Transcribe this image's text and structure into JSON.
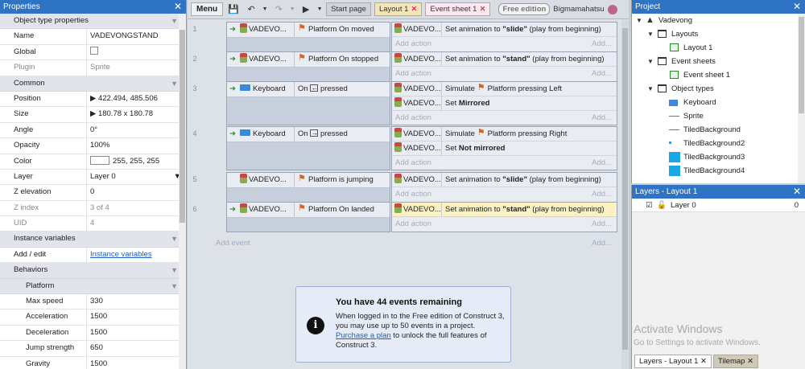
{
  "properties": {
    "title": "Properties",
    "close": "✕",
    "section_object": "Object type properties",
    "name_label": "Name",
    "name_value": "VADEVONGSTAND",
    "global_label": "Global",
    "plugin_label": "Plugin",
    "plugin_value": "Sprite",
    "section_common": "Common",
    "position_label": "Position",
    "position_value": "422.494, 485.506",
    "size_label": "Size",
    "size_value": "180.78 x 180.78",
    "angle_label": "Angle",
    "angle_value": "0°",
    "opacity_label": "Opacity",
    "opacity_value": "100%",
    "color_label": "Color",
    "color_value": "255, 255, 255",
    "layer_label": "Layer",
    "layer_value": "Layer 0",
    "zelev_label": "Z elevation",
    "zelev_value": "0",
    "zindex_label": "Z index",
    "zindex_value": "3 of 4",
    "uid_label": "UID",
    "uid_value": "4",
    "section_instvars": "Instance variables",
    "addedit_label": "Add / edit",
    "addedit_value": "Instance variables",
    "section_behaviors": "Behaviors",
    "section_platform": "Platform",
    "maxspeed_label": "Max speed",
    "maxspeed_value": "330",
    "accel_label": "Acceleration",
    "accel_value": "1500",
    "decel_label": "Deceleration",
    "decel_value": "1500",
    "jump_label": "Jump strength",
    "jump_value": "650",
    "gravity_label": "Gravity",
    "gravity_value": "1500"
  },
  "toolbar": {
    "menu": "Menu",
    "tabs": [
      "Start page",
      "Layout 1",
      "Event sheet 1"
    ],
    "edition": "Free edition",
    "user": "Bigmamahatsu"
  },
  "events": {
    "add_action": "Add action",
    "add_action_short": "Add...",
    "add_event": "Add event",
    "add_event_short": "Add...",
    "list": [
      {
        "num": "1",
        "cond_obj": "VADEVO...",
        "cond": "Platform On moved",
        "a1_obj": "VADEVO...",
        "a1_pre": "Set animation to ",
        "a1_bold": "\"slide\"",
        "a1_post": " (play from beginning)"
      },
      {
        "num": "2",
        "cond_obj": "VADEVO...",
        "cond": "Platform On stopped",
        "a1_obj": "VADEVO...",
        "a1_pre": "Set animation to ",
        "a1_bold": "\"stand\"",
        "a1_post": " (play from beginning)"
      },
      {
        "num": "3",
        "cond_obj": "Keyboard",
        "cond_on": "On",
        "cond_key": "←",
        "cond_pressed": "pressed",
        "a1_obj": "VADEVO...",
        "a1_pre": "Simulate",
        "a1_plat": "Platform pressing Left",
        "a2_obj": "VADEVO...",
        "a2_pre": "Set ",
        "a2_bold": "Mirrored"
      },
      {
        "num": "4",
        "cond_obj": "Keyboard",
        "cond_on": "On",
        "cond_key": "→",
        "cond_pressed": "pressed",
        "a1_obj": "VADEVO...",
        "a1_pre": "Simulate",
        "a1_plat": "Platform pressing Right",
        "a2_obj": "VADEVO...",
        "a2_pre": "Set ",
        "a2_bold": "Not mirrored"
      },
      {
        "num": "5",
        "cond_obj": "VADEVO...",
        "cond": "Platform is jumping",
        "a1_obj": "VADEVO...",
        "a1_pre": "Set animation to ",
        "a1_bold": "\"slide\"",
        "a1_post": " (play from beginning)"
      },
      {
        "num": "6",
        "cond_obj": "VADEVO...",
        "cond": "Platform On landed",
        "a1_obj": "VADEVO...",
        "a1_pre": "Set animation to ",
        "a1_bold": "\"stand\"",
        "a1_post": " (play from beginning)"
      }
    ]
  },
  "notice": {
    "icon": "i",
    "title": "You have 44 events remaining",
    "body_pre": "When logged in to the Free edition of Construct 3, you may use up to 50 events in a project. ",
    "link": "Purchase a plan",
    "body_post": " to unlock the full features of Construct 3."
  },
  "project": {
    "title": "Project",
    "root": "Vadevong",
    "layouts": "Layouts",
    "layout1": "Layout 1",
    "eventsheets": "Event sheets",
    "eventsheet1": "Event sheet 1",
    "objecttypes": "Object types",
    "objects": [
      "Keyboard",
      "Sprite",
      "TiledBackground",
      "TiledBackground2",
      "TiledBackground3",
      "TiledBackground4"
    ]
  },
  "layers": {
    "title": "Layers - Layout 1",
    "layer_name": "Layer 0",
    "layer_count": "0",
    "watermark_title": "Activate Windows",
    "watermark_sub": "Go to Settings to activate Windows.",
    "tab_layers": "Layers - Layout 1",
    "tab_tilemap": "Tilemap"
  }
}
